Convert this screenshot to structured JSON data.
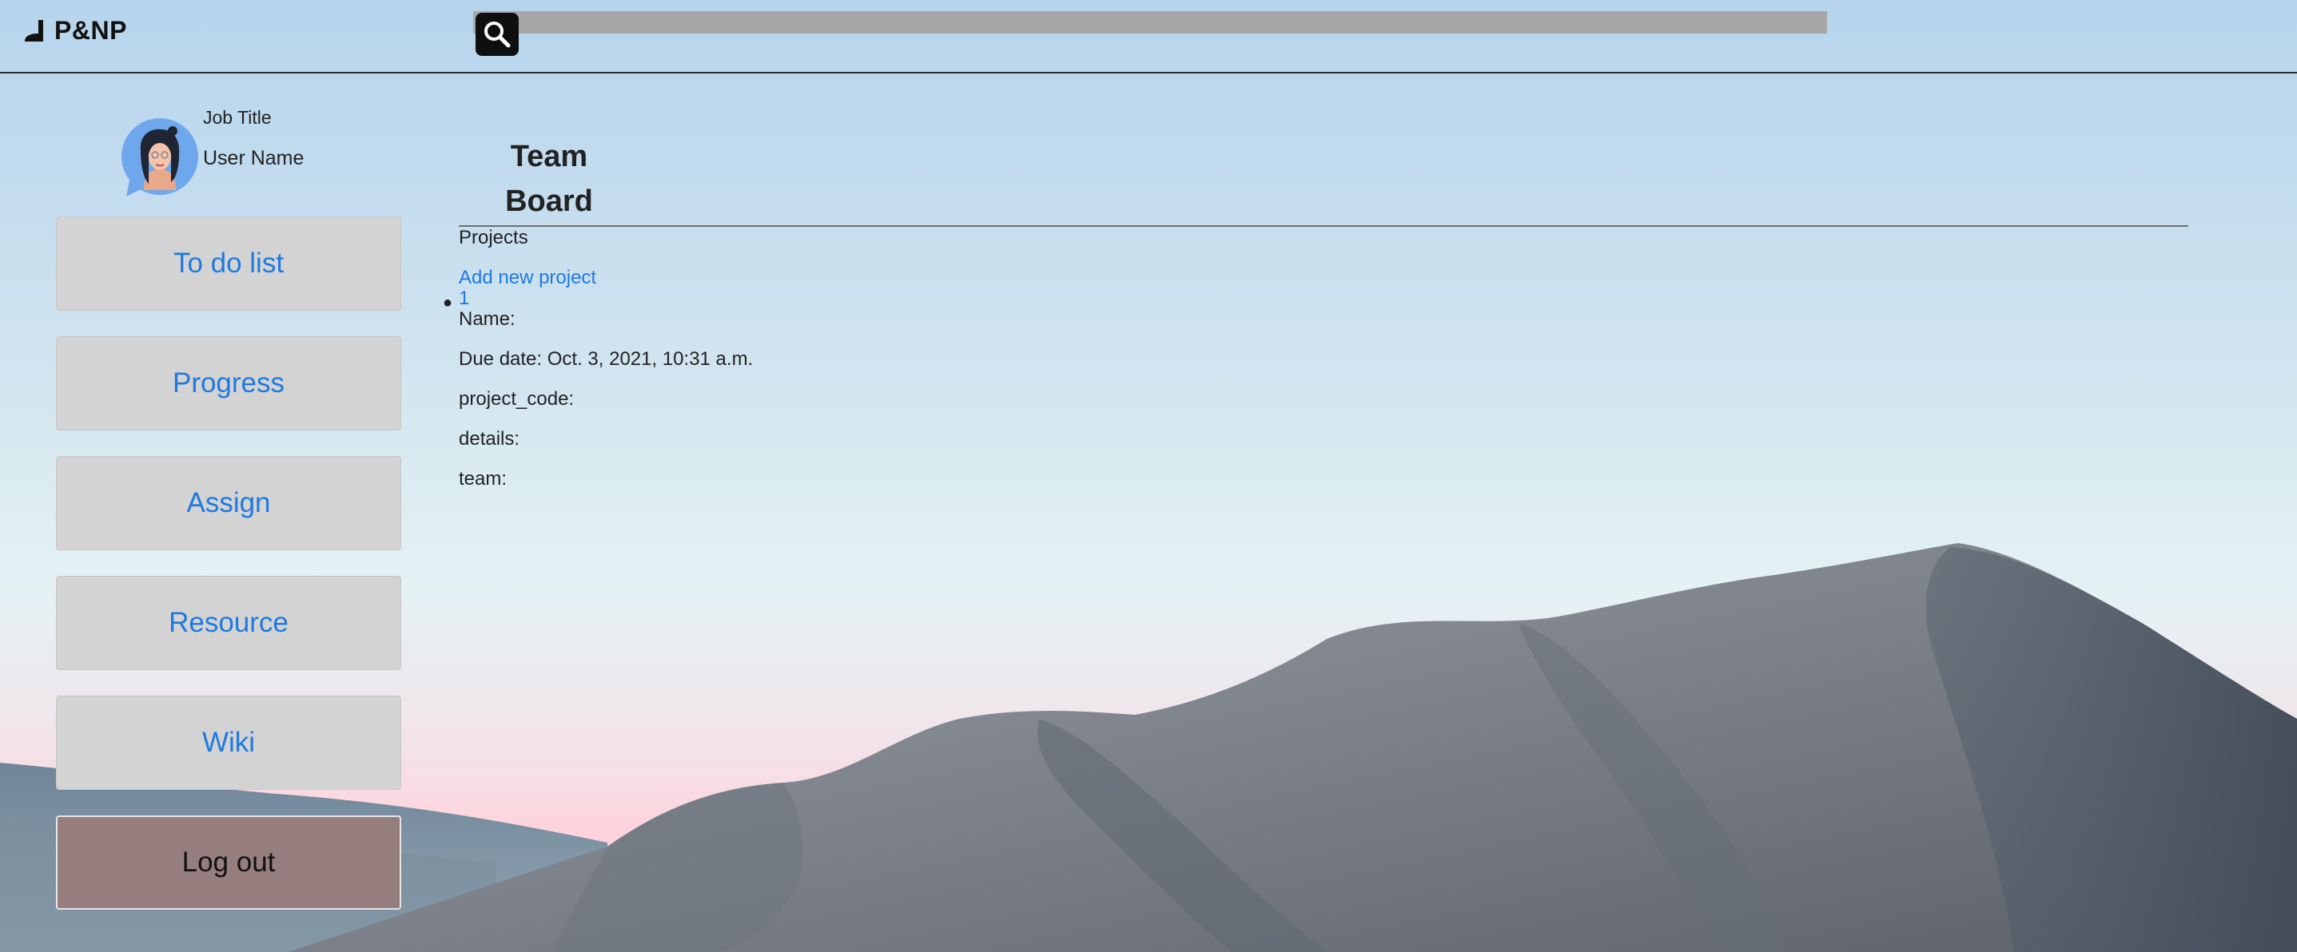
{
  "header": {
    "logo_text": "P&NP",
    "search": {
      "value": "",
      "icon": "search-icon"
    }
  },
  "profile": {
    "job_title": "Job Title",
    "user_name": "User Name"
  },
  "sidebar": {
    "items": [
      {
        "label": "To do list"
      },
      {
        "label": "Progress"
      },
      {
        "label": "Assign"
      },
      {
        "label": "Resource"
      },
      {
        "label": "Wiki"
      }
    ],
    "logout_label": "Log out"
  },
  "main": {
    "title_line1": "Team",
    "title_line2": "Board",
    "projects_label": "Projects",
    "add_project_label": "Add new project",
    "project": {
      "id": "1",
      "name_label": "Name:",
      "due_date_label": "Due date: Oct. 3, 2021, 10:31 a.m.",
      "project_code_label": "project_code:",
      "details_label": "details:",
      "team_label": "team:"
    }
  },
  "colors": {
    "link": "#1f7ae0",
    "button_bg": "#d3d3d3",
    "logout_bg": "#977e7e",
    "search_bar": "#a7a7a7"
  }
}
